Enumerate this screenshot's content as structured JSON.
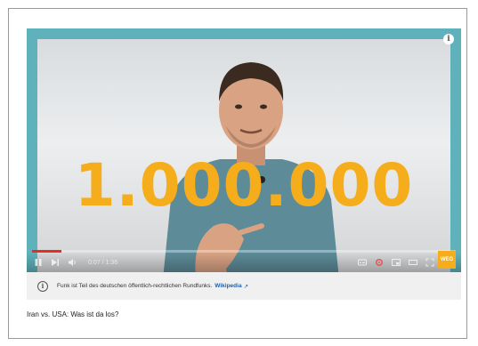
{
  "video": {
    "overlay_number": "1.000.000",
    "time": "0:07 / 1:36",
    "channel_logo": "WEG",
    "progress": 0.07
  },
  "notice": {
    "text": "Funk ist Teil des deutschen öffentlich-rechtlichen Rundfunks.",
    "link": "Wikipedia",
    "link_icon": "↗"
  },
  "title": "Iran vs. USA: Was ist da los?",
  "colors": {
    "frame": "#5fb2bb",
    "overlay": "#f5ad1c",
    "link": "#1a62b8"
  },
  "icons": [
    "info-icon",
    "pause-icon",
    "next-icon",
    "volume-icon",
    "subtitles-icon",
    "settings-icon",
    "miniplayer-icon",
    "theater-icon",
    "fullscreen-icon",
    "external-link-icon"
  ]
}
